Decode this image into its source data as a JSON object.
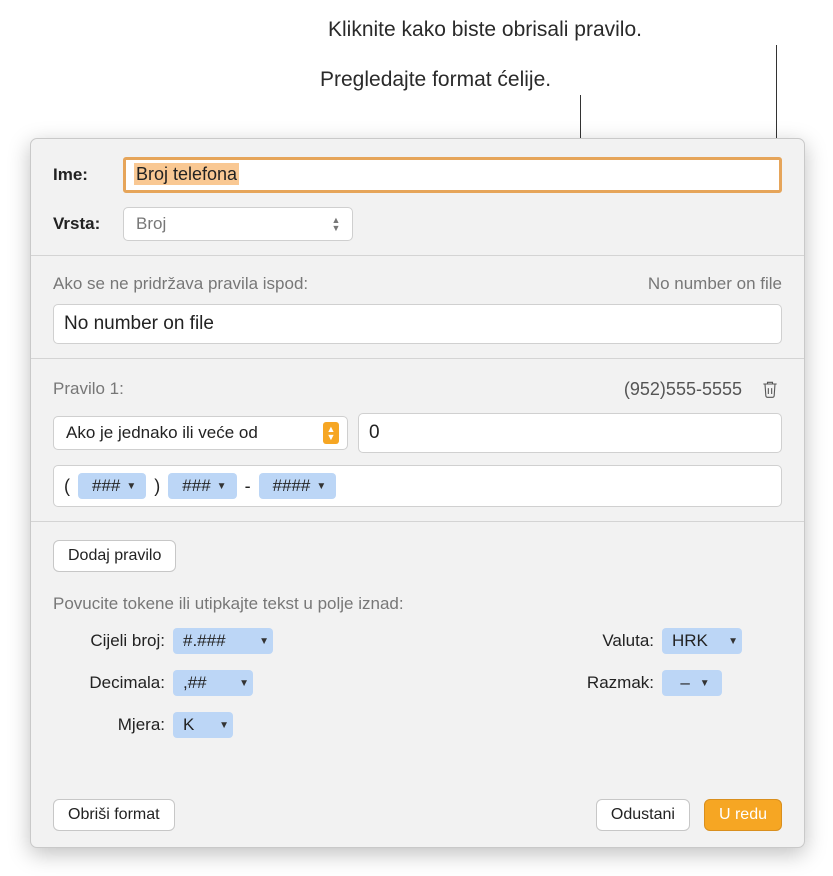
{
  "annotations": {
    "delete_rule": "Kliknite kako biste obrisali pravilo.",
    "preview_format": "Pregledajte format ćelije."
  },
  "header": {
    "name_label": "Ime:",
    "name_value": "Broj telefona",
    "type_label": "Vrsta:",
    "type_value": "Broj"
  },
  "default_rule": {
    "caption": "Ako se ne pridržava pravila ispod:",
    "preview": "No number on file",
    "value": "No number on file"
  },
  "rule1": {
    "title": "Pravilo 1:",
    "preview": "(952)555-5555",
    "condition": "Ako je jednako ili veće od",
    "value": "0",
    "pattern": {
      "open": "(",
      "t1": "###",
      "close": ")",
      "t2": "###",
      "dash": "-",
      "t3": "####"
    }
  },
  "add_rule_btn": "Dodaj pravilo",
  "tokens_help": "Povucite tokene ili utipkajte tekst u polje iznad:",
  "tokens": {
    "integer_lbl": "Cijeli broj:",
    "integer_val": "#.###",
    "decimal_lbl": "Decimala:",
    "decimal_val": ",##",
    "unit_lbl": "Mjera:",
    "unit_val": "K",
    "currency_lbl": "Valuta:",
    "currency_val": "HRK",
    "space_lbl": "Razmak:",
    "space_val": "–"
  },
  "footer": {
    "delete_format": "Obriši format",
    "cancel": "Odustani",
    "ok": "U redu"
  }
}
